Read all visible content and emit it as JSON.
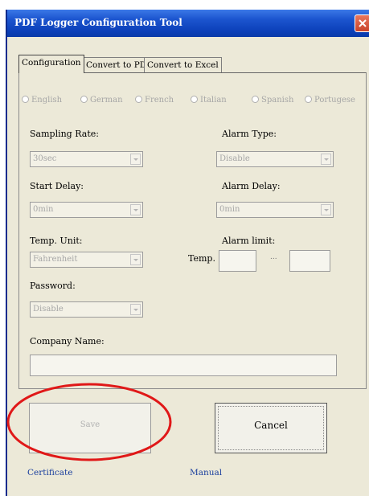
{
  "window": {
    "title": "PDF Logger Configuration Tool",
    "close_symbol": "X"
  },
  "tabs": [
    "Configuration",
    "Convert to PDF",
    "Convert to Excel"
  ],
  "languages": [
    "English",
    "German",
    "French",
    "Italian",
    "Spanish",
    "Portugese"
  ],
  "fields": {
    "sampling_rate": {
      "label": "Sampling Rate:",
      "value": "30sec"
    },
    "alarm_type": {
      "label": "Alarm Type:",
      "value": "Disable"
    },
    "start_delay": {
      "label": "Start Delay:",
      "value": "0min"
    },
    "alarm_delay": {
      "label": "Alarm Delay:",
      "value": "0min"
    },
    "temp_unit": {
      "label": "Temp. Unit:",
      "value": "Fahrenheit"
    },
    "alarm_limit": {
      "label": "Alarm limit:",
      "temp_label": "Temp.",
      "separator": "...",
      "low": "",
      "high": ""
    },
    "password": {
      "label": "Password:",
      "value": "Disable"
    },
    "company_name": {
      "label": "Company Name:",
      "value": ""
    }
  },
  "buttons": {
    "save": "Save",
    "cancel": "Cancel"
  },
  "links": {
    "certificate": "Certificate",
    "manual": "Manual"
  },
  "colors": {
    "title_bar": "#0b3fb8",
    "annotation": "#e01818",
    "link": "#1a3f9e",
    "disabled_text": "#a6a6a6"
  }
}
